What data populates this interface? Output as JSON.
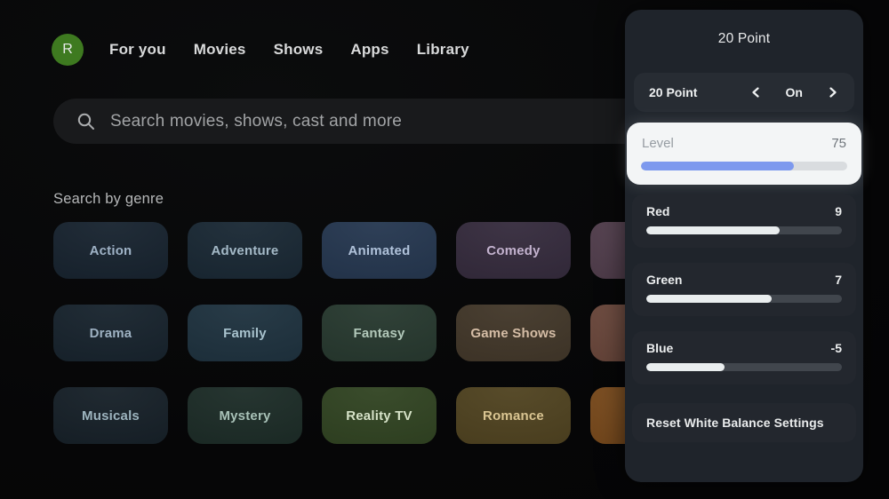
{
  "nav": {
    "avatar_initial": "R",
    "avatar_color": "#3e7a20",
    "items": [
      {
        "label": "For you"
      },
      {
        "label": "Movies"
      },
      {
        "label": "Shows"
      },
      {
        "label": "Apps"
      },
      {
        "label": "Library"
      }
    ]
  },
  "search": {
    "placeholder": "Search movies, shows, cast and more",
    "icon": "magnifier"
  },
  "genre_section": {
    "title": "Search by genre",
    "tiles": [
      {
        "label": "Action",
        "bg": "#16222e",
        "fg": "#9fb2c6"
      },
      {
        "label": "Adventure",
        "bg": "#182733",
        "fg": "#a4b9c7"
      },
      {
        "label": "Animated",
        "bg": "#24364f",
        "fg": "#b0c2da"
      },
      {
        "label": "Comedy",
        "bg": "#342a3c",
        "fg": "#c3b2ce"
      },
      {
        "label": "",
        "bg": "#533f4e",
        "fg": "#c3b2ce"
      },
      {
        "label": "Drama",
        "bg": "#16222c",
        "fg": "#9db0c1"
      },
      {
        "label": "Family",
        "bg": "#1d313e",
        "fg": "#a8c2cd"
      },
      {
        "label": "Fantasy",
        "bg": "#26382e",
        "fg": "#b2c8ba"
      },
      {
        "label": "Game Shows",
        "bg": "#413628",
        "fg": "#d5bda6"
      },
      {
        "label": "",
        "bg": "#6c483c",
        "fg": "#d5bda6"
      },
      {
        "label": "Musicals",
        "bg": "#151f27",
        "fg": "#9db4be"
      },
      {
        "label": "Mystery",
        "bg": "#1b2b26",
        "fg": "#a8c1b7"
      },
      {
        "label": "Reality TV",
        "bg": "#304321",
        "fg": "#d6e2c8"
      },
      {
        "label": "Romance",
        "bg": "#4f421f",
        "fg": "#dac592"
      },
      {
        "label": "",
        "bg": "#7b4b1c",
        "fg": "#dac592"
      }
    ]
  },
  "panel": {
    "title": "20 Point",
    "selector": {
      "label": "20 Point",
      "value": "On",
      "left_icon": "chevron-left",
      "right_icon": "chevron-right"
    },
    "accent_blue": "#7d99ee",
    "sliders": [
      {
        "label": "Level",
        "value": "75",
        "fill": "74%",
        "selected": true
      },
      {
        "label": "Red",
        "value": "9",
        "fill": "68%"
      },
      {
        "label": "Green",
        "value": "7",
        "fill": "64%"
      },
      {
        "label": "Blue",
        "value": "-5",
        "fill": "40%"
      }
    ],
    "reset_label": "Reset White Balance Settings"
  }
}
